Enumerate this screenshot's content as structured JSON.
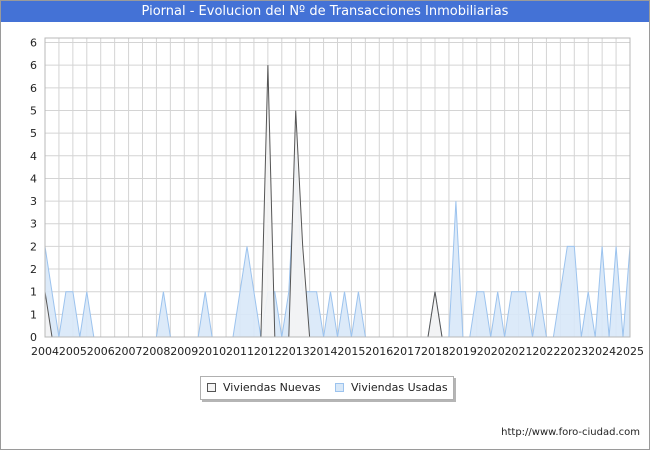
{
  "window": {
    "title": "Piornal - Evolucion del Nº de Transacciones Inmobiliarias",
    "footer_url": "http://www.foro-ciudad.com"
  },
  "colors": {
    "title_bar": "#4472d6",
    "nuevas_fill": "#f4f4f4",
    "nuevas_stroke": "#555555",
    "usadas_fill": "#d8e8f8",
    "usadas_stroke": "#9cc3ee",
    "grid": "#d4d4d4"
  },
  "chart_data": {
    "type": "area",
    "title": "Piornal - Evolucion del Nº de Transacciones Inmobiliarias",
    "xlabel": "",
    "ylabel": "",
    "x_range": [
      2004,
      2025
    ],
    "ylim": [
      0,
      6.6
    ],
    "y_tick_values": [
      0,
      0.5,
      1,
      1.5,
      2,
      2.5,
      3,
      3.5,
      4,
      4.5,
      5,
      5.5,
      6,
      6.5
    ],
    "y_tick_labels": [
      "0",
      "1",
      "1",
      "2",
      "2",
      "3",
      "3",
      "4",
      "4",
      "5",
      "5",
      "6",
      "6",
      "6"
    ],
    "x_tick_labels": [
      "2004",
      "2005",
      "2006",
      "2007",
      "2008",
      "2009",
      "2010",
      "2011",
      "2012",
      "2013",
      "2014",
      "2015",
      "2016",
      "2017",
      "2018",
      "2019",
      "2020",
      "2021",
      "2022",
      "2023",
      "2024",
      "2025"
    ],
    "grid": true,
    "legend_position": "bottom-center",
    "series": [
      {
        "name": "Viviendas Usadas",
        "x": [
          2004.0,
          2004.5,
          2004.75,
          2005.0,
          2005.25,
          2005.5,
          2005.75,
          2006.0,
          2008.0,
          2008.25,
          2008.5,
          2009.5,
          2009.75,
          2010.0,
          2010.75,
          2011.0,
          2011.25,
          2011.5,
          2011.75,
          2012.0,
          2012.25,
          2012.5,
          2012.75,
          2013.0,
          2013.25,
          2013.5,
          2013.75,
          2014.0,
          2014.25,
          2014.5,
          2014.75,
          2015.0,
          2015.25,
          2015.5,
          2015.75,
          2016.0,
          2017.75,
          2018.0,
          2018.25,
          2018.5,
          2018.75,
          2019.0,
          2019.25,
          2019.5,
          2019.75,
          2020.0,
          2020.25,
          2020.5,
          2020.75,
          2021.0,
          2021.25,
          2021.5,
          2021.75,
          2022.0,
          2022.25,
          2022.5,
          2022.75,
          2023.0,
          2023.25,
          2023.5,
          2023.75,
          2024.0,
          2024.25,
          2024.5,
          2024.75,
          2025.0
        ],
        "values": [
          2,
          0,
          1,
          1,
          0,
          1,
          0,
          0,
          0,
          1,
          0,
          0,
          1,
          0,
          0,
          1,
          2,
          1,
          0,
          1,
          1,
          0,
          1,
          4,
          1,
          1,
          1,
          0,
          1,
          0,
          1,
          0,
          1,
          0,
          0,
          0,
          0,
          1,
          0,
          0,
          3,
          0,
          0,
          1,
          1,
          0,
          1,
          0,
          1,
          1,
          1,
          0,
          1,
          0,
          0,
          1,
          2,
          2,
          0,
          1,
          0,
          2,
          0,
          2,
          0,
          2
        ]
      },
      {
        "name": "Viviendas Nuevas",
        "x": [
          2004.0,
          2004.25,
          2011.75,
          2012.0,
          2012.25,
          2012.75,
          2013.0,
          2013.25,
          2013.5,
          2017.75,
          2018.0,
          2018.25
        ],
        "values": [
          1,
          0,
          0,
          6,
          0,
          0,
          5,
          2,
          0,
          0,
          1,
          0
        ]
      }
    ]
  }
}
